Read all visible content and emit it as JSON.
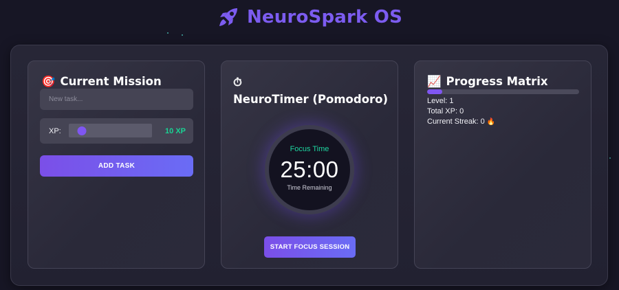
{
  "app": {
    "title": "NeuroSpark OS",
    "logo_icon": "rocket-icon",
    "brand_color": "#7c5cf0"
  },
  "mission": {
    "icon": "target-icon",
    "emoji": "🎯",
    "title": "Current Mission",
    "task_placeholder": "New task...",
    "task_value": "",
    "xp_label": "XP:",
    "xp_slider_fraction": 0.16,
    "xp_value_text": "10 XP",
    "add_button": "ADD TASK"
  },
  "timer": {
    "icon": "stopwatch-icon",
    "emoji": "⏱",
    "title": "NeuroTimer (Pomodoro)",
    "mode": "Focus Time",
    "time": "25:00",
    "subtitle": "Time Remaining",
    "start_button": "START FOCUS SESSION"
  },
  "progress": {
    "icon": "chart-increasing-icon",
    "emoji": "📈",
    "title": "Progress Matrix",
    "xp_bar_fraction": 0.1,
    "level_text": "Level: 1",
    "total_xp_text": "Total XP: 0",
    "streak_text": "Current Streak: 0",
    "streak_icon": "fire-icon",
    "streak_emoji": "🔥"
  },
  "colors": {
    "accent_purple": "#7f56f2",
    "accent_green": "#19d494",
    "background": "#171625"
  }
}
